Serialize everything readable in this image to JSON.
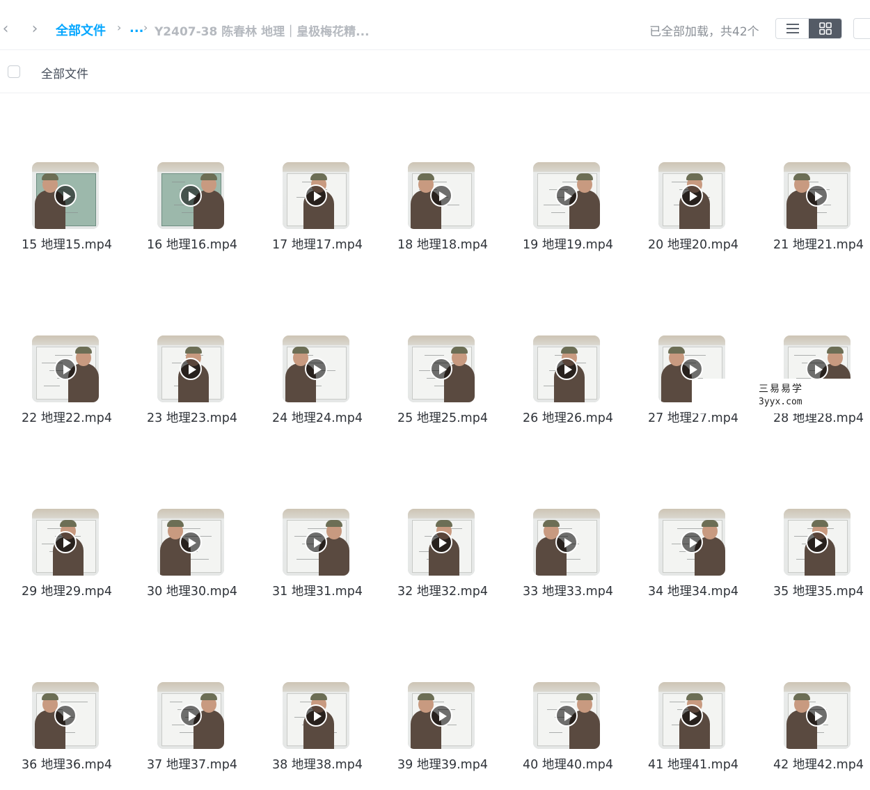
{
  "nav": {
    "back_icon": "chevron-left-icon",
    "forward_icon": "chevron-right-icon",
    "back_glyph": "‹",
    "forward_glyph": "›"
  },
  "breadcrumb": {
    "root": "全部文件",
    "sep": "›",
    "ellipsis": "...",
    "current": "Y2407-38 陈春林 地理｜皇极梅花精..."
  },
  "status": {
    "loaded": "已全部加载，共42个"
  },
  "view": {
    "list_icon": "list-view-icon",
    "grid_icon": "grid-view-icon",
    "active": "grid"
  },
  "subbar": {
    "label": "全部文件"
  },
  "files": [
    {
      "name": "15 地理15.mp4",
      "board": "green"
    },
    {
      "name": "16 地理16.mp4",
      "board": "green"
    },
    {
      "name": "17 地理17.mp4",
      "board": "white"
    },
    {
      "name": "18 地理18.mp4",
      "board": "white"
    },
    {
      "name": "19 地理19.mp4",
      "board": "white"
    },
    {
      "name": "20 地理20.mp4",
      "board": "white"
    },
    {
      "name": "21 地理21.mp4",
      "board": "white"
    },
    {
      "name": "22 地理22.mp4",
      "board": "white"
    },
    {
      "name": "23 地理23.mp4",
      "board": "white"
    },
    {
      "name": "24 地理24.mp4",
      "board": "white"
    },
    {
      "name": "25 地理25.mp4",
      "board": "white"
    },
    {
      "name": "26 地理26.mp4",
      "board": "white"
    },
    {
      "name": "27 地理27.mp4",
      "board": "white"
    },
    {
      "name": "28 地理28.mp4",
      "board": "white"
    },
    {
      "name": "29 地理29.mp4",
      "board": "white"
    },
    {
      "name": "30 地理30.mp4",
      "board": "white"
    },
    {
      "name": "31 地理31.mp4",
      "board": "white"
    },
    {
      "name": "32 地理32.mp4",
      "board": "white"
    },
    {
      "name": "33 地理33.mp4",
      "board": "white"
    },
    {
      "name": "34 地理34.mp4",
      "board": "white"
    },
    {
      "name": "35 地理35.mp4",
      "board": "white"
    },
    {
      "name": "36 地理36.mp4",
      "board": "white"
    },
    {
      "name": "37 地理37.mp4",
      "board": "white"
    },
    {
      "name": "38 地理38.mp4",
      "board": "white"
    },
    {
      "name": "39 地理39.mp4",
      "board": "white"
    },
    {
      "name": "40 地理40.mp4",
      "board": "white"
    },
    {
      "name": "41 地理41.mp4",
      "board": "white"
    },
    {
      "name": "42 地理42.mp4",
      "board": "white"
    }
  ],
  "watermark": {
    "line1": "三易易学",
    "line2": "3yyx.com"
  },
  "colors": {
    "accent": "#06a7ff",
    "muted": "#b5b9bf",
    "toggle_active": "#545b66"
  }
}
